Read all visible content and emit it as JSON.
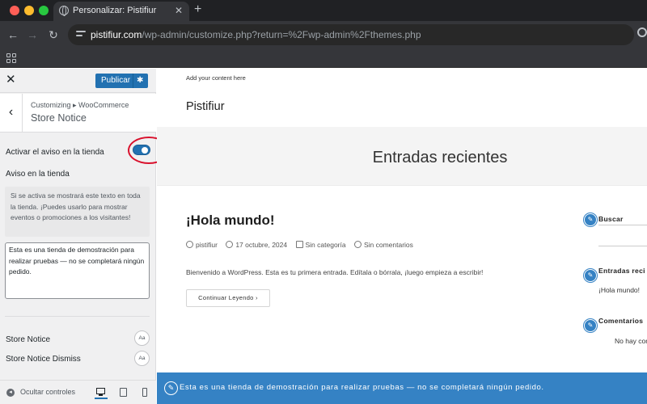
{
  "browser": {
    "tab_title": "Personalizar: Pistifiur",
    "url_host": "pistifiur.com",
    "url_path": "/wp-admin/customize.php?return=%2Fwp-admin%2Fthemes.php"
  },
  "customizer": {
    "publish_label": "Publicar",
    "breadcrumb": "Customizing ▸ WooCommerce",
    "section_title": "Store Notice",
    "toggle_label": "Activar el aviso en la tienda",
    "toggle_on": true,
    "field_label": "Aviso en la tienda",
    "field_description": "Si se activa se mostrará este texto en toda la tienda. ¡Puedes usarlo para mostrar eventos o promociones a los visitantes!",
    "notice_value": "Esta es una tienda de demostración para realizar pruebas — no se completará ningún pedido.",
    "style_rows": [
      {
        "label": "Store Notice",
        "badge": "Aa"
      },
      {
        "label": "Store Notice Dismiss",
        "badge": "Aa"
      }
    ],
    "hide_controls_label": "Ocultar controles"
  },
  "preview": {
    "tagline": "Add your content here",
    "site_title": "Pistifiur",
    "hero_title": "Entradas recientes",
    "post": {
      "title": "¡Hola mundo!",
      "author": "pistifiur",
      "date": "17 octubre, 2024",
      "category": "Sin categoría",
      "comments": "Sin comentarios",
      "excerpt": "Bienvenido a WordPress. Esta es tu primera entrada. Edítala o bórrala, ¡luego empieza a escribir!",
      "read_more": "Continuar Leyendo"
    },
    "sidebar": {
      "search_title": "Buscar",
      "recent_title": "Entradas reci",
      "recent_item": "¡Hola mundo!",
      "comments_title": "Comentarios",
      "comments_item": "No hay com"
    },
    "store_notice": "Esta es una tienda de demostración para realizar pruebas — no se completará ningún pedido.",
    "colors": {
      "accent": "#2271b1",
      "notice_bar": "#3582c4",
      "highlight": "#d9112d"
    }
  }
}
